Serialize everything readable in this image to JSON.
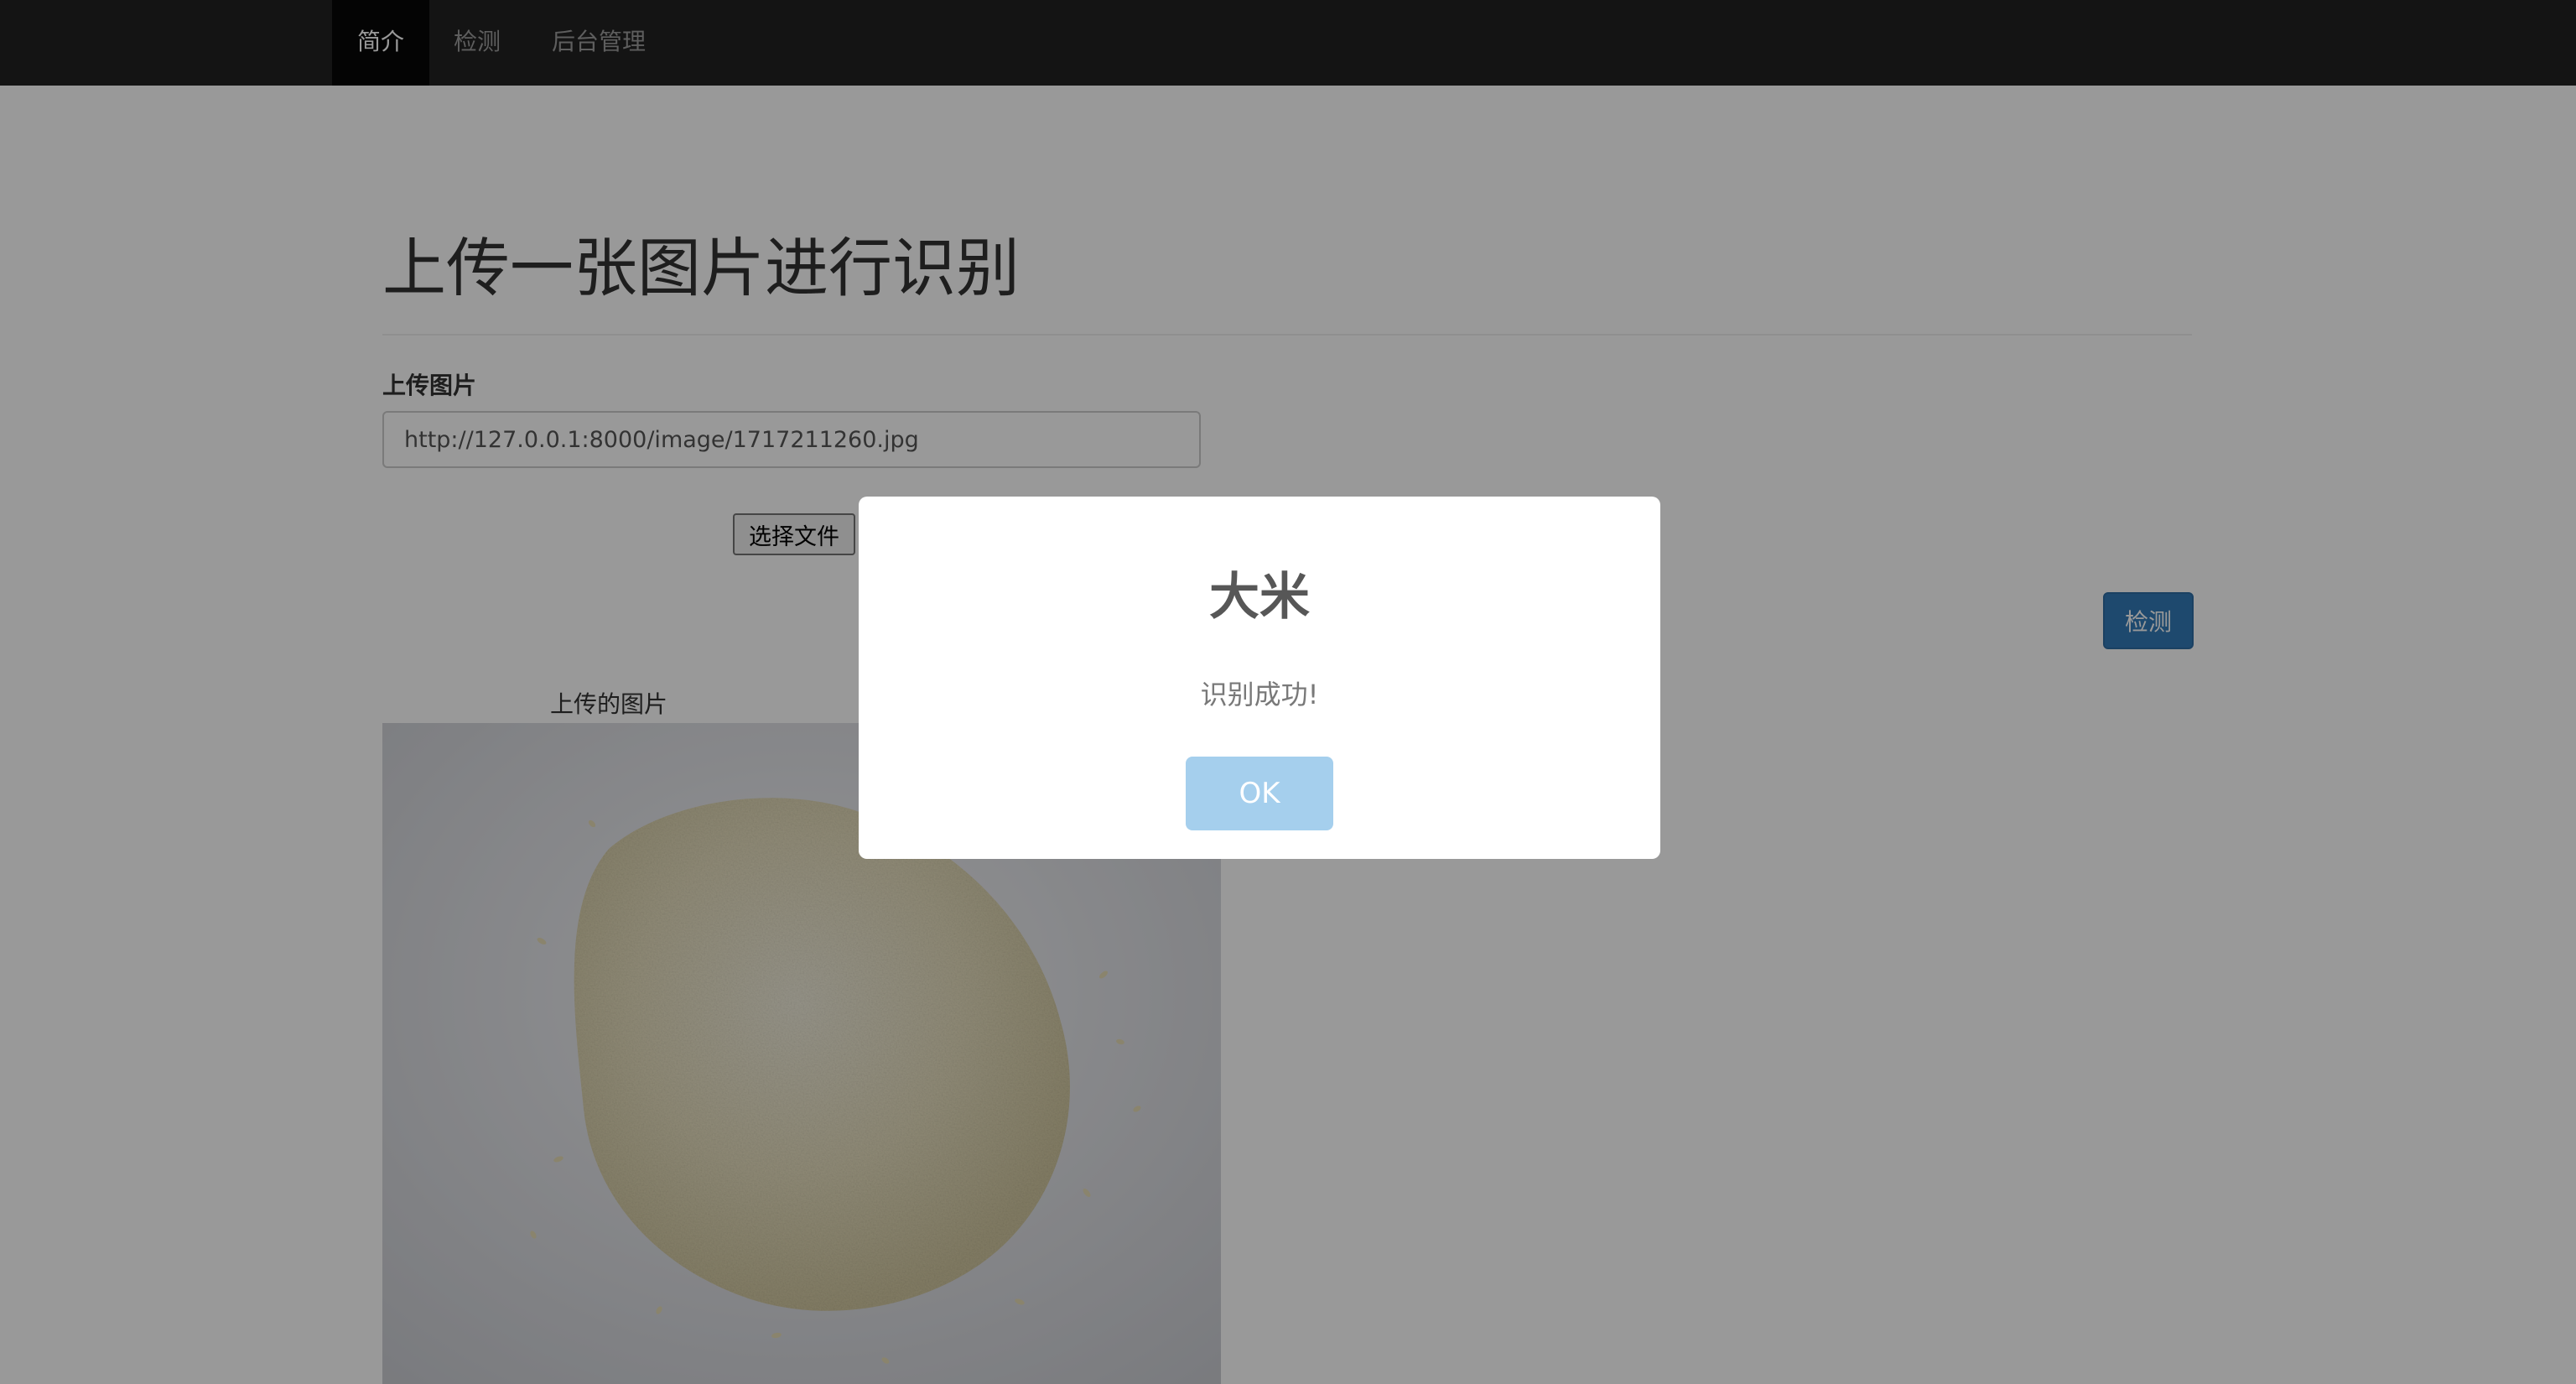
{
  "navbar": {
    "items": [
      {
        "label": "简介",
        "active": true
      },
      {
        "label": "检测",
        "active": false
      },
      {
        "label": "后台管理",
        "active": false
      }
    ]
  },
  "main": {
    "title": "上传一张图片进行识别",
    "upload_label": "上传图片",
    "image_url": "http://127.0.0.1:8000/image/1717211260.jpg",
    "file_button_label": "选择文件",
    "detect_button_label": "检测",
    "image_caption": "上传的图片"
  },
  "modal": {
    "title": "大米",
    "text": "识别成功!",
    "ok_label": "OK"
  },
  "colors": {
    "navbar_bg": "#222222",
    "primary_button": "#337ab7",
    "ok_button": "#a5cfed",
    "overlay": "rgba(0,0,0,0.4)"
  }
}
